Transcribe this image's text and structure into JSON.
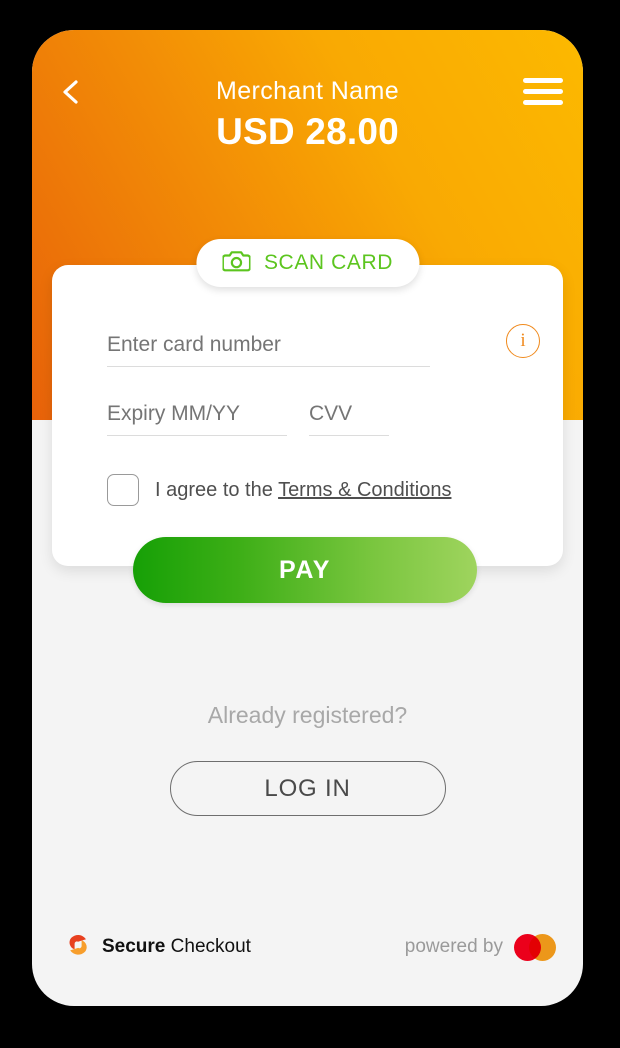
{
  "header": {
    "merchant_name": "Merchant Name",
    "amount": "USD 28.00",
    "back_icon": "chevron-left-icon",
    "menu_icon": "hamburger-menu-icon",
    "gradient_from": "#e8620a",
    "gradient_to": "#fcb900"
  },
  "scan_card": {
    "label": "SCAN CARD",
    "icon": "camera-icon",
    "color": "#5cc51f"
  },
  "form": {
    "card_number": {
      "value": "",
      "placeholder": "Enter card number"
    },
    "expiry": {
      "value": "",
      "placeholder": "Expiry MM/YY"
    },
    "cvv": {
      "value": "",
      "placeholder": "CVV"
    },
    "info_icon": "info-circle-icon",
    "info_icon_glyph": "i",
    "info_color": "#f08a1d"
  },
  "terms": {
    "checked": false,
    "prefix": "I agree to the ",
    "link_label": "Terms & Conditions"
  },
  "pay": {
    "label": "PAY",
    "gradient_from": "#16a006",
    "gradient_to": "#9fd45e"
  },
  "login": {
    "prompt": "Already registered?",
    "button_label": "LOG IN"
  },
  "footer": {
    "secure_bold": "Secure",
    "secure_rest": " Checkout",
    "logo_icon": "secure-swirl-logo-icon",
    "powered_by": "powered by",
    "card_brand_icon": "mastercard-icon",
    "mc_red": "#eb001b",
    "mc_yellow": "#f79e1b"
  }
}
